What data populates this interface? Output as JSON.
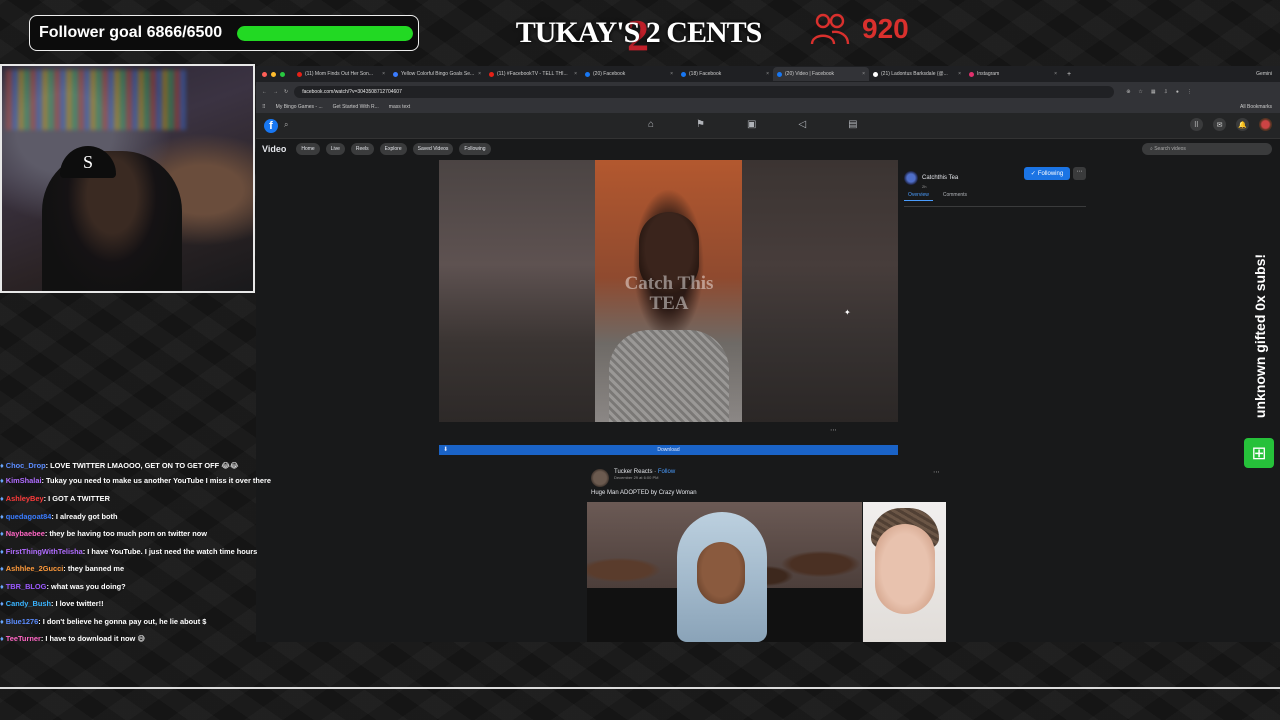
{
  "overlay": {
    "follower_goal_label": "Follower goal 6866/6500",
    "follower_goal_progress": 1.0,
    "brand": "TUKAY'S 2 CENTS",
    "viewer_count": "920",
    "sub_alert": "unknown gifted 0x subs!",
    "colors": {
      "goal_bar": "#22d923",
      "viewer_red": "#d9302d",
      "sub_green": "#26c13a"
    }
  },
  "browser": {
    "tabs": [
      {
        "label": "(11) Mom Finds Out Her Son...",
        "favicon_color": "#e62117",
        "active": false
      },
      {
        "label": "Yellow Colorful Bingo Goals Se...",
        "favicon_color": "#3a7cff",
        "active": false
      },
      {
        "label": "(11) #FacebookTV - TELL THI...",
        "favicon_color": "#e62117",
        "active": false
      },
      {
        "label": "(20) Facebook",
        "favicon_color": "#1877f2",
        "active": false
      },
      {
        "label": "(18) Facebook",
        "favicon_color": "#1877f2",
        "active": false
      },
      {
        "label": "(20) Video | Facebook",
        "favicon_color": "#1877f2",
        "active": true
      },
      {
        "label": "(21) Ladontus Barksdale (@...",
        "favicon_color": "#ffffff",
        "active": false
      },
      {
        "label": "Instagram",
        "favicon_color": "#e1306c",
        "active": false
      }
    ],
    "new_tab": "+",
    "gemini": "Gemini",
    "url": "facebook.com/watch/?v=3043508712704607",
    "bookmarks": [
      "My Bingo Games - ...",
      "Get Started With R...",
      "mass text"
    ],
    "all_bookmarks": "All Bookmarks"
  },
  "facebook": {
    "logo": "f",
    "nav_icons": [
      "home-icon",
      "flag-icon",
      "marketplace-icon",
      "megaphone-icon",
      "gaming-icon"
    ],
    "video_title": "Video",
    "video_nav": [
      "Home",
      "Live",
      "Reels",
      "Explore",
      "Saved Videos",
      "Following"
    ],
    "search_placeholder": "Search videos",
    "watermark_line1": "Catch This",
    "watermark_line2": "TEA",
    "download_label": "Download",
    "channel_name": "Catchthis Tea",
    "channel_time": "2h",
    "following_label": "Following",
    "info_tabs": [
      "Overview",
      "Comments"
    ],
    "post": {
      "author": "Tucker Reacts",
      "follow": "Follow",
      "date": "December 29 at 6:00 PM",
      "caption": "Huge Man ADOPTED by Crazy Woman"
    }
  },
  "chat": [
    {
      "user": "Choc_Drop",
      "color": "#5b8cff",
      "text": "LOVE TWITTER LMAOOO, GET ON TO GET OFF 😂😂",
      "wrap": true
    },
    {
      "user": "KimShalai",
      "color": "#b06cff",
      "text": "Tukay you need to make us another YouTube I miss it over there",
      "wrap": true
    },
    {
      "user": "AshleyBey",
      "color": "#ff3b3b",
      "text": "I GOT A TWITTER",
      "wrap": false
    },
    {
      "user": "quedagoat84",
      "color": "#3a7cff",
      "text": "I already got both",
      "wrap": false
    },
    {
      "user": "Naybaebee",
      "color": "#ff66c4",
      "text": "they be having too much porn on twitter now",
      "wrap": false
    },
    {
      "user": "FirstThingWithTelisha",
      "color": "#b06cff",
      "text": "I have YouTube. I just need the watch time hours",
      "wrap": false
    },
    {
      "user": "Ashhlee_2Gucci",
      "color": "#ff9a3b",
      "text": "they banned me",
      "wrap": false
    },
    {
      "user": "TBR_BLOG",
      "color": "#9b59ff",
      "text": "what was you doing?",
      "wrap": false
    },
    {
      "user": "Candy_Bush",
      "color": "#3ab4ff",
      "text": "I love twitter!!",
      "wrap": false
    },
    {
      "user": "Blue1276",
      "color": "#5b8cff",
      "text": "I don't believe he gonna pay out, he lie about $",
      "wrap": false
    },
    {
      "user": "TeeTurner",
      "color": "#ff66c4",
      "text": "I have to download it now 😅",
      "wrap": false
    }
  ]
}
